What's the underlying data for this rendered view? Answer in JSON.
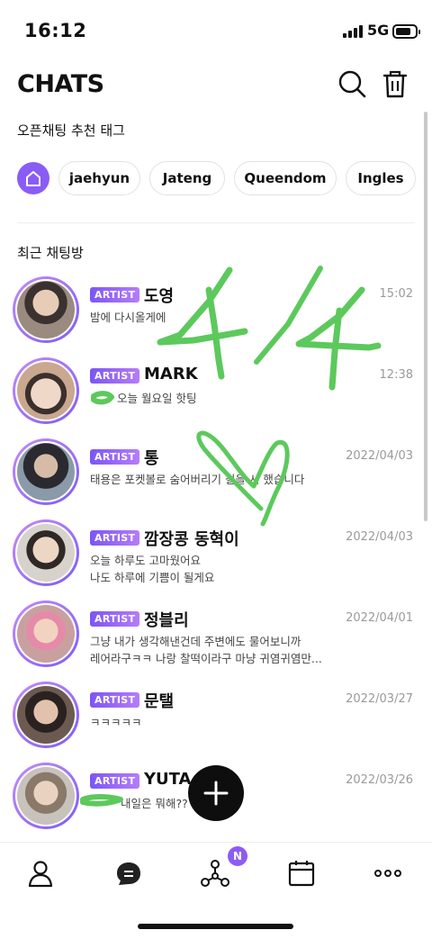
{
  "status_bar": {
    "time": "16:12",
    "network": "5G"
  },
  "header": {
    "title": "CHATS",
    "search_icon": "search-icon",
    "trash_icon": "trash-icon"
  },
  "tags": {
    "label": "오픈채팅 추천 태그",
    "home_icon": "home-icon",
    "items": [
      "jaehyun",
      "Jateng",
      "Queendom",
      "Ingles"
    ]
  },
  "recent": {
    "label": "최근 채팅방",
    "chats": [
      {
        "badge": "ARTIST",
        "name": "도영",
        "time": "15:02",
        "message": "밤에 다시올게에 ",
        "message2": ""
      },
      {
        "badge": "ARTIST",
        "name": "MARK",
        "time": "12:38",
        "message": "오늘 월요일 핫팅",
        "message2": ""
      },
      {
        "badge": "ARTIST",
        "name": "통",
        "time": "2022/04/03",
        "message": "태용은 포켓볼로 숨어버리기 길을 시 했습니다",
        "message2": ""
      },
      {
        "badge": "ARTIST",
        "name": "깜장콩 동혁이",
        "time": "2022/04/03",
        "message": "오늘 하루도 고마웠어요",
        "message2": "나도 하루에 기쁨이 될게요"
      },
      {
        "badge": "ARTIST",
        "name": "정블리",
        "time": "2022/04/01",
        "message": "그냥 내가 생각해낸건데 주변에도 물어보니까",
        "message2": "레어라구ㅋㅋ 나랑 찰떡이라구 마냥 귀염귀염만..."
      },
      {
        "badge": "ARTIST",
        "name": "문탤",
        "time": "2022/03/27",
        "message": "ㅋㅋㅋㅋㅋ",
        "message2": ""
      },
      {
        "badge": "ARTIST",
        "name": "YUTA",
        "time": "2022/03/26",
        "message": "내일은 뭐해??",
        "message2": ""
      }
    ]
  },
  "fab": {
    "icon": "plus-icon"
  },
  "tabbar": {
    "items": [
      "profile-icon",
      "chat-icon",
      "network-icon",
      "calendar-icon",
      "more-icon"
    ],
    "badge": "N"
  },
  "colors": {
    "accent": "#8a5cf6",
    "scribble": "#5cc95c"
  }
}
